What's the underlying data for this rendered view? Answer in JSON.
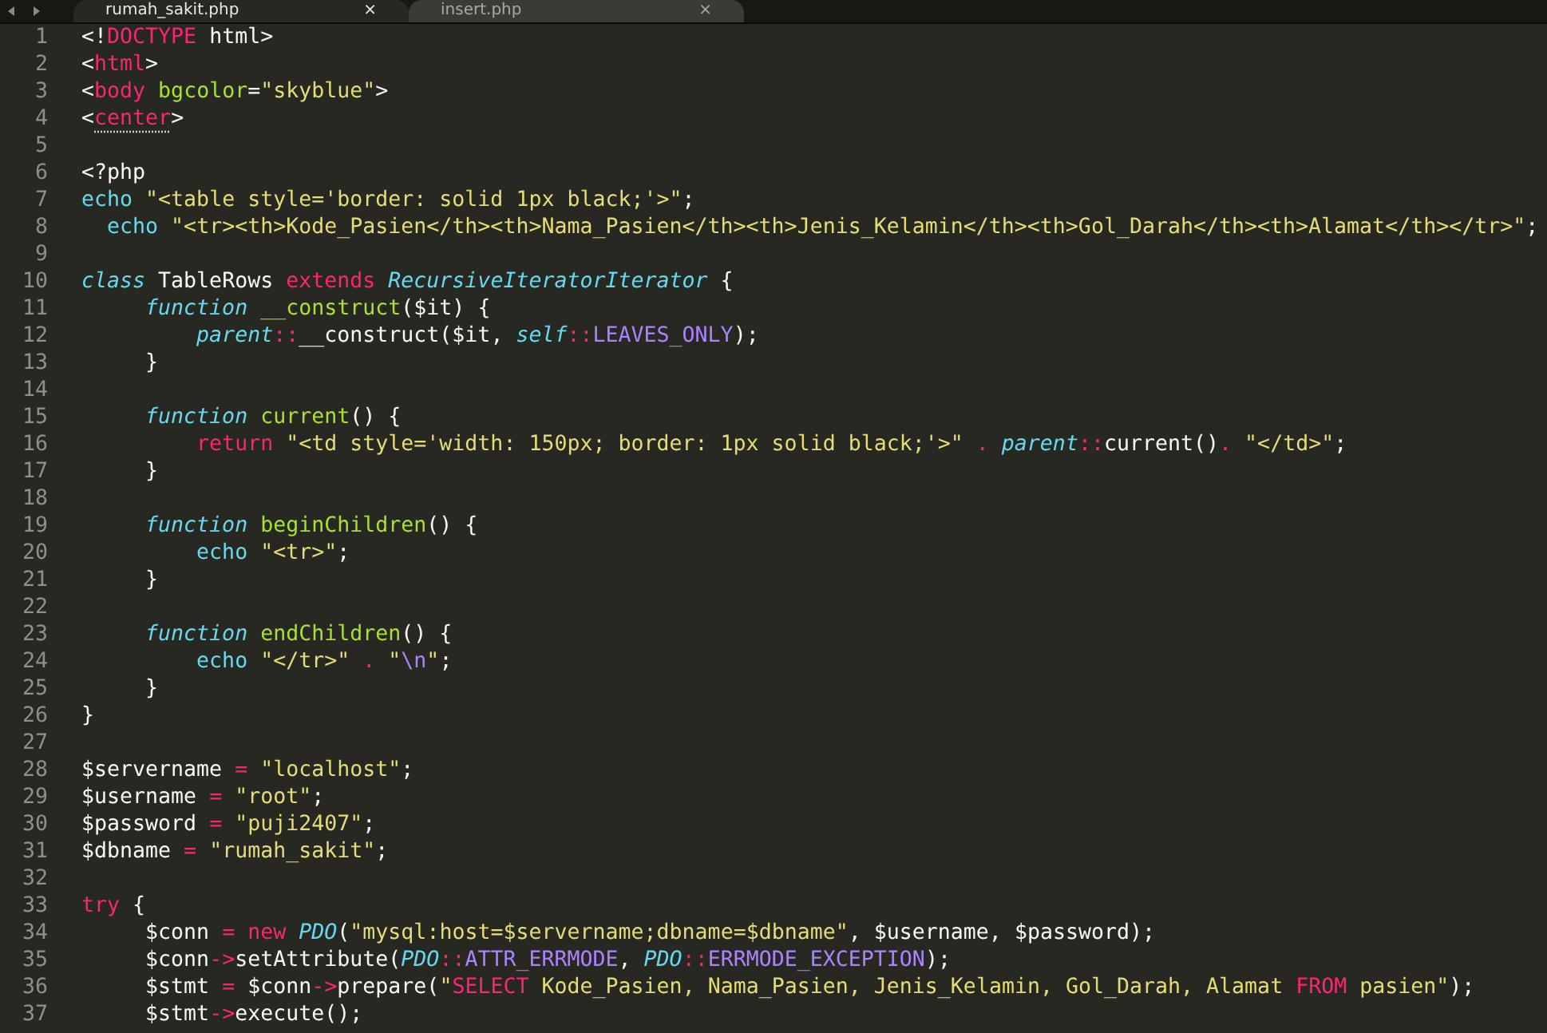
{
  "tabs": [
    {
      "label": "rumah_sakit.php",
      "close": "×",
      "selected": true
    },
    {
      "label": "insert.php",
      "close": "×",
      "selected": false
    }
  ],
  "lines": [
    {
      "number": "1",
      "tokens": [
        {
          "kind": "plain",
          "text": "<!"
        },
        {
          "kind": "keyword",
          "text": "DOCTYPE"
        },
        {
          "kind": "plain",
          "text": " html>"
        }
      ]
    },
    {
      "number": "2",
      "tokens": [
        {
          "kind": "plain",
          "text": "<"
        },
        {
          "kind": "keyword",
          "text": "html"
        },
        {
          "kind": "plain",
          "text": ">"
        }
      ]
    },
    {
      "number": "3",
      "tokens": [
        {
          "kind": "plain",
          "text": "<"
        },
        {
          "kind": "keyword",
          "text": "body"
        },
        {
          "kind": "function",
          "text": " bgcolor"
        },
        {
          "kind": "plain",
          "text": "="
        },
        {
          "kind": "string",
          "text": "\"skyblue\""
        },
        {
          "kind": "plain",
          "text": ">"
        }
      ]
    },
    {
      "number": "4",
      "tokens": [
        {
          "kind": "plain",
          "text": "<"
        },
        {
          "kind": "flagged",
          "text": "center"
        },
        {
          "kind": "plain",
          "text": ">"
        }
      ]
    },
    {
      "number": "5"
    },
    {
      "number": "6",
      "tokens": [
        {
          "kind": "plain",
          "text": "<?php"
        }
      ]
    },
    {
      "number": "7",
      "tokens": [
        {
          "kind": "support",
          "text": "echo"
        },
        {
          "kind": "string",
          "text": " \"<table style='border: solid 1px black;'>\""
        },
        {
          "kind": "plain",
          "text": ";"
        }
      ]
    },
    {
      "number": "8",
      "tokens": [
        {
          "kind": "support",
          "text": "  echo"
        },
        {
          "kind": "string",
          "text": " \"<tr><th>Kode_Pasien</th><th>Nama_Pasien</th><th>Jenis_Kelamin</th><th>Gol_Darah</th><th>Alamat</th></tr>\""
        },
        {
          "kind": "plain",
          "text": ";"
        }
      ]
    },
    {
      "number": "9"
    },
    {
      "number": "10",
      "tokens": [
        {
          "kind": "type",
          "text": "class"
        },
        {
          "kind": "plain",
          "text": " TableRows "
        },
        {
          "kind": "keyword",
          "text": "extends"
        },
        {
          "kind": "type",
          "text": " RecursiveIteratorIterator"
        },
        {
          "kind": "plain",
          "text": " {"
        }
      ]
    },
    {
      "number": "11",
      "tokens": [
        {
          "kind": "type",
          "text": "     function"
        },
        {
          "kind": "function",
          "text": " __construct"
        },
        {
          "kind": "plain",
          "text": "($it) {"
        }
      ]
    },
    {
      "number": "12",
      "tokens": [
        {
          "kind": "type",
          "text": "         parent"
        },
        {
          "kind": "keyword",
          "text": "::"
        },
        {
          "kind": "plain",
          "text": "__construct($it, "
        },
        {
          "kind": "type",
          "text": "self"
        },
        {
          "kind": "keyword",
          "text": "::"
        },
        {
          "kind": "constant",
          "text": "LEAVES_ONLY"
        },
        {
          "kind": "plain",
          "text": ");"
        }
      ]
    },
    {
      "number": "13",
      "tokens": [
        {
          "kind": "plain",
          "text": "     }"
        }
      ]
    },
    {
      "number": "14"
    },
    {
      "number": "15",
      "tokens": [
        {
          "kind": "type",
          "text": "     function"
        },
        {
          "kind": "function",
          "text": " current"
        },
        {
          "kind": "plain",
          "text": "() {"
        }
      ]
    },
    {
      "number": "16",
      "tokens": [
        {
          "kind": "keyword",
          "text": "         return"
        },
        {
          "kind": "string",
          "text": " \"<td style='width: 150px; border: 1px solid black;'>\""
        },
        {
          "kind": "keyword",
          "text": " ."
        },
        {
          "kind": "type",
          "text": " parent"
        },
        {
          "kind": "keyword",
          "text": "::"
        },
        {
          "kind": "plain",
          "text": "current()"
        },
        {
          "kind": "keyword",
          "text": "."
        },
        {
          "kind": "string",
          "text": " \"</td>\""
        },
        {
          "kind": "plain",
          "text": ";"
        }
      ]
    },
    {
      "number": "17",
      "tokens": [
        {
          "kind": "plain",
          "text": "     }"
        }
      ]
    },
    {
      "number": "18"
    },
    {
      "number": "19",
      "tokens": [
        {
          "kind": "type",
          "text": "     function"
        },
        {
          "kind": "function",
          "text": " beginChildren"
        },
        {
          "kind": "plain",
          "text": "() {"
        }
      ]
    },
    {
      "number": "20",
      "tokens": [
        {
          "kind": "support",
          "text": "         echo"
        },
        {
          "kind": "string",
          "text": " \"<tr>\""
        },
        {
          "kind": "plain",
          "text": ";"
        }
      ]
    },
    {
      "number": "21",
      "tokens": [
        {
          "kind": "plain",
          "text": "     }"
        }
      ]
    },
    {
      "number": "22"
    },
    {
      "number": "23",
      "tokens": [
        {
          "kind": "type",
          "text": "     function"
        },
        {
          "kind": "function",
          "text": " endChildren"
        },
        {
          "kind": "plain",
          "text": "() {"
        }
      ]
    },
    {
      "number": "24",
      "tokens": [
        {
          "kind": "support",
          "text": "         echo"
        },
        {
          "kind": "string",
          "text": " \"</tr>\""
        },
        {
          "kind": "keyword",
          "text": " ."
        },
        {
          "kind": "string",
          "text": " \""
        },
        {
          "kind": "constant",
          "text": "\\n"
        },
        {
          "kind": "string",
          "text": "\""
        },
        {
          "kind": "plain",
          "text": ";"
        }
      ]
    },
    {
      "number": "25",
      "tokens": [
        {
          "kind": "plain",
          "text": "     }"
        }
      ]
    },
    {
      "number": "26",
      "tokens": [
        {
          "kind": "plain",
          "text": "}"
        }
      ]
    },
    {
      "number": "27"
    },
    {
      "number": "28",
      "tokens": [
        {
          "kind": "plain",
          "text": "$servername "
        },
        {
          "kind": "keyword",
          "text": "="
        },
        {
          "kind": "string",
          "text": " \"localhost\""
        },
        {
          "kind": "plain",
          "text": ";"
        }
      ]
    },
    {
      "number": "29",
      "tokens": [
        {
          "kind": "plain",
          "text": "$username "
        },
        {
          "kind": "keyword",
          "text": "="
        },
        {
          "kind": "string",
          "text": " \"root\""
        },
        {
          "kind": "plain",
          "text": ";"
        }
      ]
    },
    {
      "number": "30",
      "tokens": [
        {
          "kind": "plain",
          "text": "$password "
        },
        {
          "kind": "keyword",
          "text": "="
        },
        {
          "kind": "string",
          "text": " \"puji2407\""
        },
        {
          "kind": "plain",
          "text": ";"
        }
      ]
    },
    {
      "number": "31",
      "tokens": [
        {
          "kind": "plain",
          "text": "$dbname "
        },
        {
          "kind": "keyword",
          "text": "="
        },
        {
          "kind": "string",
          "text": " \"rumah_sakit\""
        },
        {
          "kind": "plain",
          "text": ";"
        }
      ]
    },
    {
      "number": "32"
    },
    {
      "number": "33",
      "tokens": [
        {
          "kind": "keyword",
          "text": "try"
        },
        {
          "kind": "plain",
          "text": " {"
        }
      ]
    },
    {
      "number": "34",
      "tokens": [
        {
          "kind": "plain",
          "text": "     $conn "
        },
        {
          "kind": "keyword",
          "text": "="
        },
        {
          "kind": "keyword",
          "text": " new"
        },
        {
          "kind": "type",
          "text": " PDO"
        },
        {
          "kind": "plain",
          "text": "("
        },
        {
          "kind": "string",
          "text": "\"mysql:host=$servername;dbname=$dbname\""
        },
        {
          "kind": "plain",
          "text": ", $username, $password);"
        }
      ]
    },
    {
      "number": "35",
      "tokens": [
        {
          "kind": "plain",
          "text": "     $conn"
        },
        {
          "kind": "keyword",
          "text": "->"
        },
        {
          "kind": "plain",
          "text": "setAttribute("
        },
        {
          "kind": "type",
          "text": "PDO"
        },
        {
          "kind": "keyword",
          "text": "::"
        },
        {
          "kind": "constant",
          "text": "ATTR_ERRMODE"
        },
        {
          "kind": "plain",
          "text": ", "
        },
        {
          "kind": "type",
          "text": "PDO"
        },
        {
          "kind": "keyword",
          "text": "::"
        },
        {
          "kind": "constant",
          "text": "ERRMODE_EXCEPTION"
        },
        {
          "kind": "plain",
          "text": ");"
        }
      ]
    },
    {
      "number": "36",
      "tokens": [
        {
          "kind": "plain",
          "text": "     $stmt "
        },
        {
          "kind": "keyword",
          "text": "="
        },
        {
          "kind": "plain",
          "text": " $conn"
        },
        {
          "kind": "keyword",
          "text": "->"
        },
        {
          "kind": "plain",
          "text": "prepare("
        },
        {
          "kind": "string",
          "text": "\""
        },
        {
          "kind": "keyword",
          "text": "SELECT"
        },
        {
          "kind": "string",
          "text": " Kode_Pasien, Nama_Pasien, Jenis_Kelamin, Gol_Darah, Alamat "
        },
        {
          "kind": "keyword",
          "text": "FROM"
        },
        {
          "kind": "string",
          "text": " pasien\""
        },
        {
          "kind": "plain",
          "text": ");"
        }
      ]
    },
    {
      "number": "37",
      "tokens": [
        {
          "kind": "plain",
          "text": "     $stmt"
        },
        {
          "kind": "keyword",
          "text": "->"
        },
        {
          "kind": "plain",
          "text": "execute();"
        }
      ]
    }
  ]
}
